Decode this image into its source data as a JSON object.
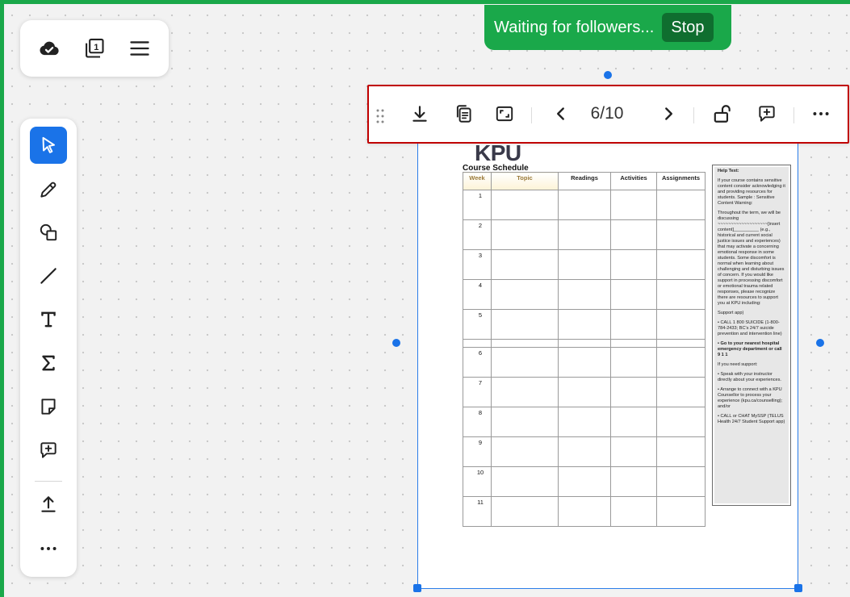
{
  "follow_banner": {
    "message": "Waiting for followers...",
    "stop_label": "Stop"
  },
  "top_toolbar": {
    "items": [
      {
        "icon": "cloud-check-icon",
        "label": "Saved"
      },
      {
        "icon": "pages-icon",
        "badge": "1"
      },
      {
        "icon": "menu-icon"
      }
    ]
  },
  "tools": [
    {
      "icon": "cursor-icon",
      "active": true
    },
    {
      "icon": "pencil-icon"
    },
    {
      "icon": "shapes-icon"
    },
    {
      "icon": "line-icon"
    },
    {
      "icon": "text-icon"
    },
    {
      "icon": "sigma-icon"
    },
    {
      "icon": "sticky-note-icon"
    },
    {
      "icon": "comment-add-icon"
    },
    {
      "icon": "upload-icon"
    },
    {
      "icon": "more-horizontal-icon"
    }
  ],
  "pdf_toolbar": {
    "page_indicator": "6/10",
    "icons": [
      "drag-grip-icon",
      "download-icon",
      "copy-to-board-icon",
      "fit-page-icon",
      "chevron-left-icon",
      "chevron-right-icon",
      "lock-open-icon",
      "comment-add-icon",
      "more-horizontal-icon"
    ]
  },
  "document": {
    "logo": "KPU",
    "subtitle": "Course Schedule",
    "columns": [
      "Week",
      "Topic",
      "Readings",
      "Activities",
      "Assignments"
    ],
    "weeks": [
      "1",
      "2",
      "3",
      "4",
      "5",
      "",
      "6",
      "7",
      "8",
      "9",
      "10",
      "11"
    ],
    "help": {
      "title": "Help Text:",
      "paragraphs": [
        "If your course contains sensitive content consider acknowledging it and providing resources for students. Sample : Sensitive Content Warning:",
        "Throughout the term, we will be discussing ~~~~~~~~~~~~~~~~~~~[insert content]__________ (e.g., historical and current social justice issues and experiences) that may activate a concerning emotional response in some students. Some discomfort is normal when learning about challenging and disturbing issues of concern. If you would like support in processing discomfort or emotional trauma related responses, please recognize there are resources to support you at KPU including:",
        "Support app)",
        "• CALL 1 800 SUICIDE (1-800-784-2433; BC's 24/7 suicide prevention and intervention line)",
        "• Go to your nearest hospital emergency department or call 9 1 1",
        "If you need support:",
        "• Speak with your instructor directly about your experiences.",
        "• Arrange to connect with a KPU Counsellor to process your experience (kpu.ca/counselling); and/or",
        "• CALL or CHAT MySSP (TELUS Health 24/7 Student Support app)"
      ]
    }
  },
  "colors": {
    "accent": "#1a73e8",
    "follow_green": "#1aa84a",
    "stop_dark": "#0f6e2f",
    "toolbar_outline": "#c00000"
  }
}
